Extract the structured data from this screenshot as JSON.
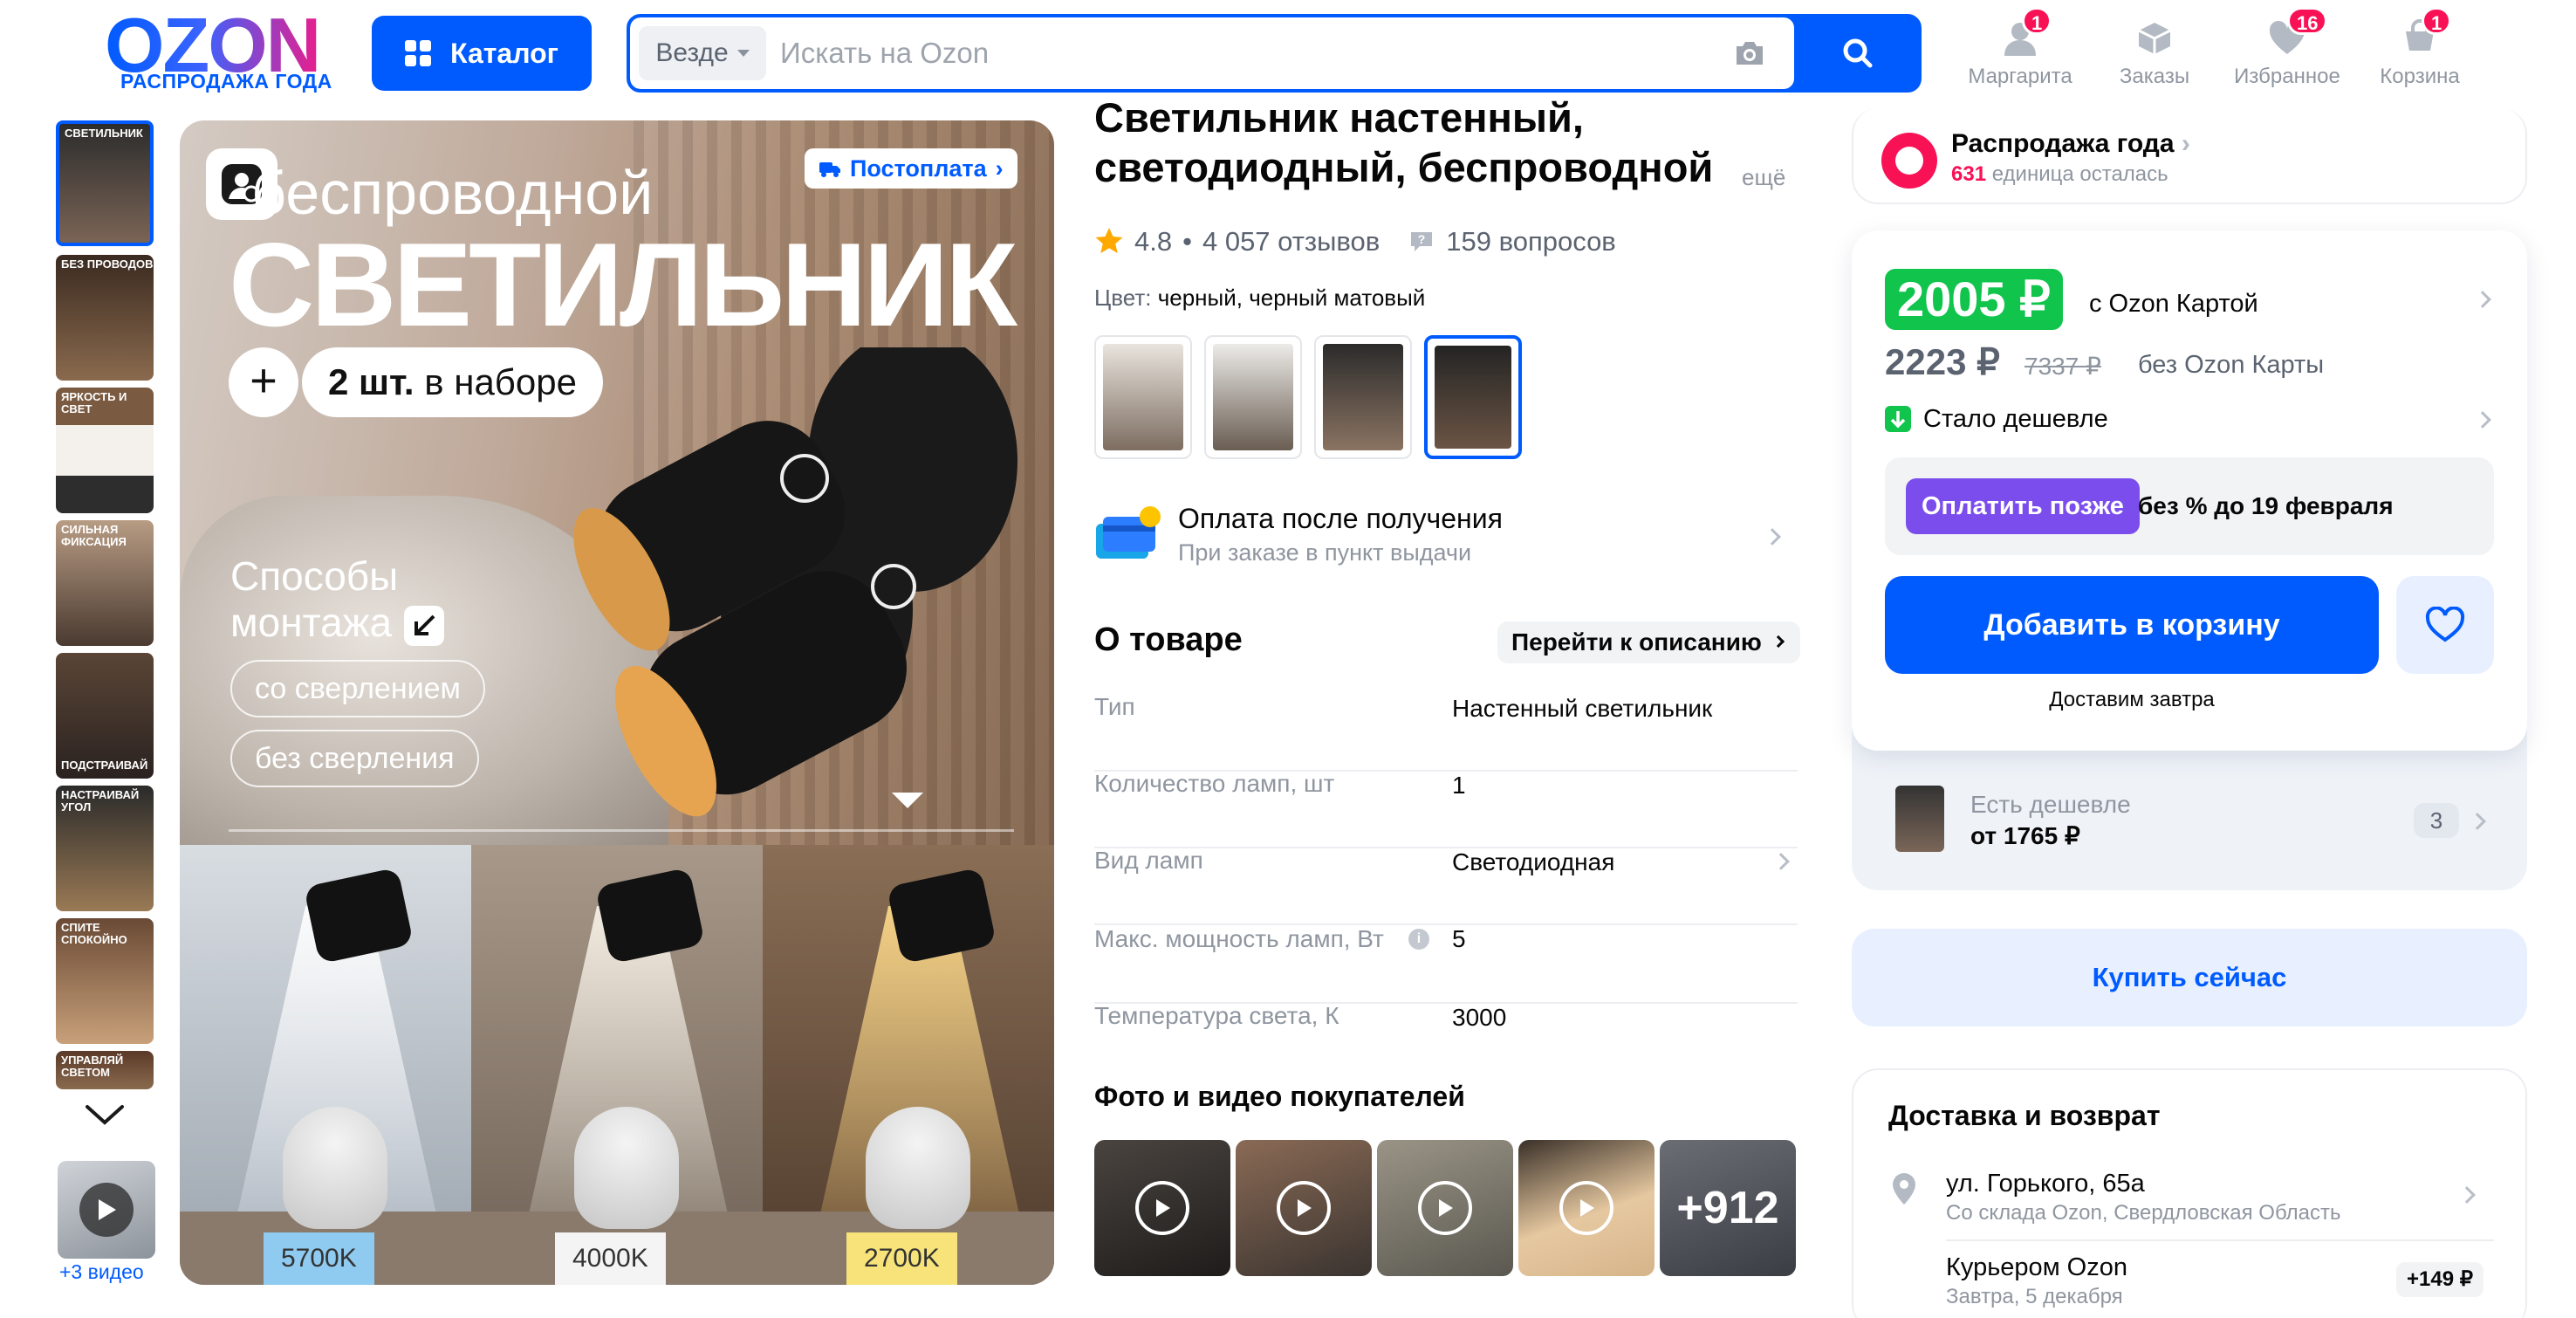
{
  "header": {
    "logo_text": "OZON",
    "logo_sub": "РАСПРОДАЖА ГОДА",
    "catalog_label": "Каталог",
    "search": {
      "scope": "Везде",
      "placeholder": "Искать на Ozon"
    },
    "nav": [
      {
        "label": "Маргарита",
        "icon": "user-icon",
        "badge": "1"
      },
      {
        "label": "Заказы",
        "icon": "box-icon",
        "badge": ""
      },
      {
        "label": "Избранное",
        "icon": "heart-icon",
        "badge": "16"
      },
      {
        "label": "Корзина",
        "icon": "cart-icon",
        "badge": "1"
      }
    ],
    "colors": {
      "brand": "#005bff",
      "badge": "#f91155"
    }
  },
  "gallery": {
    "thumbs": [
      "СВЕТИЛЬНИК",
      "БЕЗ ПРОВОДОВ",
      "ЯРКОСТЬ И СВЕТ",
      "СИЛЬНАЯ ФИКСАЦИЯ",
      "ПОДСТРАИВАЙ",
      "НАСТРАИВАЙ УГОЛ",
      "СПИТЕ СПОКОЙНО",
      "УПРАВЛЯЙ СВЕТОМ"
    ],
    "video_label": "+3 видео"
  },
  "main_image": {
    "postpay_label": "Постоплата",
    "headline_small": "беспроводной",
    "headline_big": "СВЕТИЛЬНИК",
    "plus": "+",
    "set_count": "2 шт.",
    "set_text": "в наборе",
    "mount_title_1": "Способы",
    "mount_title_2": "монтажа",
    "mount_opt_1": "со сверлением",
    "mount_opt_2": "без сверления",
    "temps": [
      "5700K",
      "4000K",
      "2700K"
    ]
  },
  "product": {
    "title": "Светильник настенный, светодиодный, беспроводной",
    "more": "ещё",
    "rating": "4.8",
    "reviews": "4 057 отзывов",
    "questions": "159 вопросов",
    "color_label": "Цвет:",
    "color_value": "черный, черный матовый",
    "pay_after_title": "Оплата после получения",
    "pay_after_sub": "При заказе в пункт выдачи",
    "about_title": "О товаре",
    "goto_desc": "Перейти к описанию",
    "specs": [
      {
        "k": "Тип",
        "v": "Настенный светильник"
      },
      {
        "k": "Количество ламп, шт",
        "v": "1"
      },
      {
        "k": "Вид ламп",
        "v": "Светодиодная"
      },
      {
        "k": "Макс. мощность ламп, Вт",
        "v": "5"
      },
      {
        "k": "Температура света, К",
        "v": "3000"
      }
    ],
    "photos_title": "Фото и видео покупателей",
    "photos_more": "+912"
  },
  "buy": {
    "sale_title": "Распродажа года",
    "sale_left_num": "631",
    "sale_left_text": "единица осталась",
    "price_card": "2005 ₽",
    "with_card": "с Ozon Картой",
    "price_no_card": "2223 ₽",
    "price_old": "7337 ₽",
    "no_card": "без Ozon Карты",
    "cheaper_now": "Стало дешевле",
    "pay_later_btn": "Оплатить позже",
    "pay_later_text": "без % до 19 февраля",
    "add_to_cart": "Добавить в корзину",
    "deliver_tomorrow": "Доставим завтра",
    "cheaper_elsewhere": "Есть дешевле",
    "cheaper_from": "от 1765 ₽",
    "cheaper_count": "3",
    "buy_now": "Купить сейчас"
  },
  "delivery": {
    "title": "Доставка и возврат",
    "address": "ул. Горького, 65а",
    "address_sub": "Со склада Ozon, Свердловская Область",
    "courier": "Курьером Ozon",
    "courier_sub": "Завтра, 5 декабря",
    "courier_price": "+149 ₽"
  }
}
